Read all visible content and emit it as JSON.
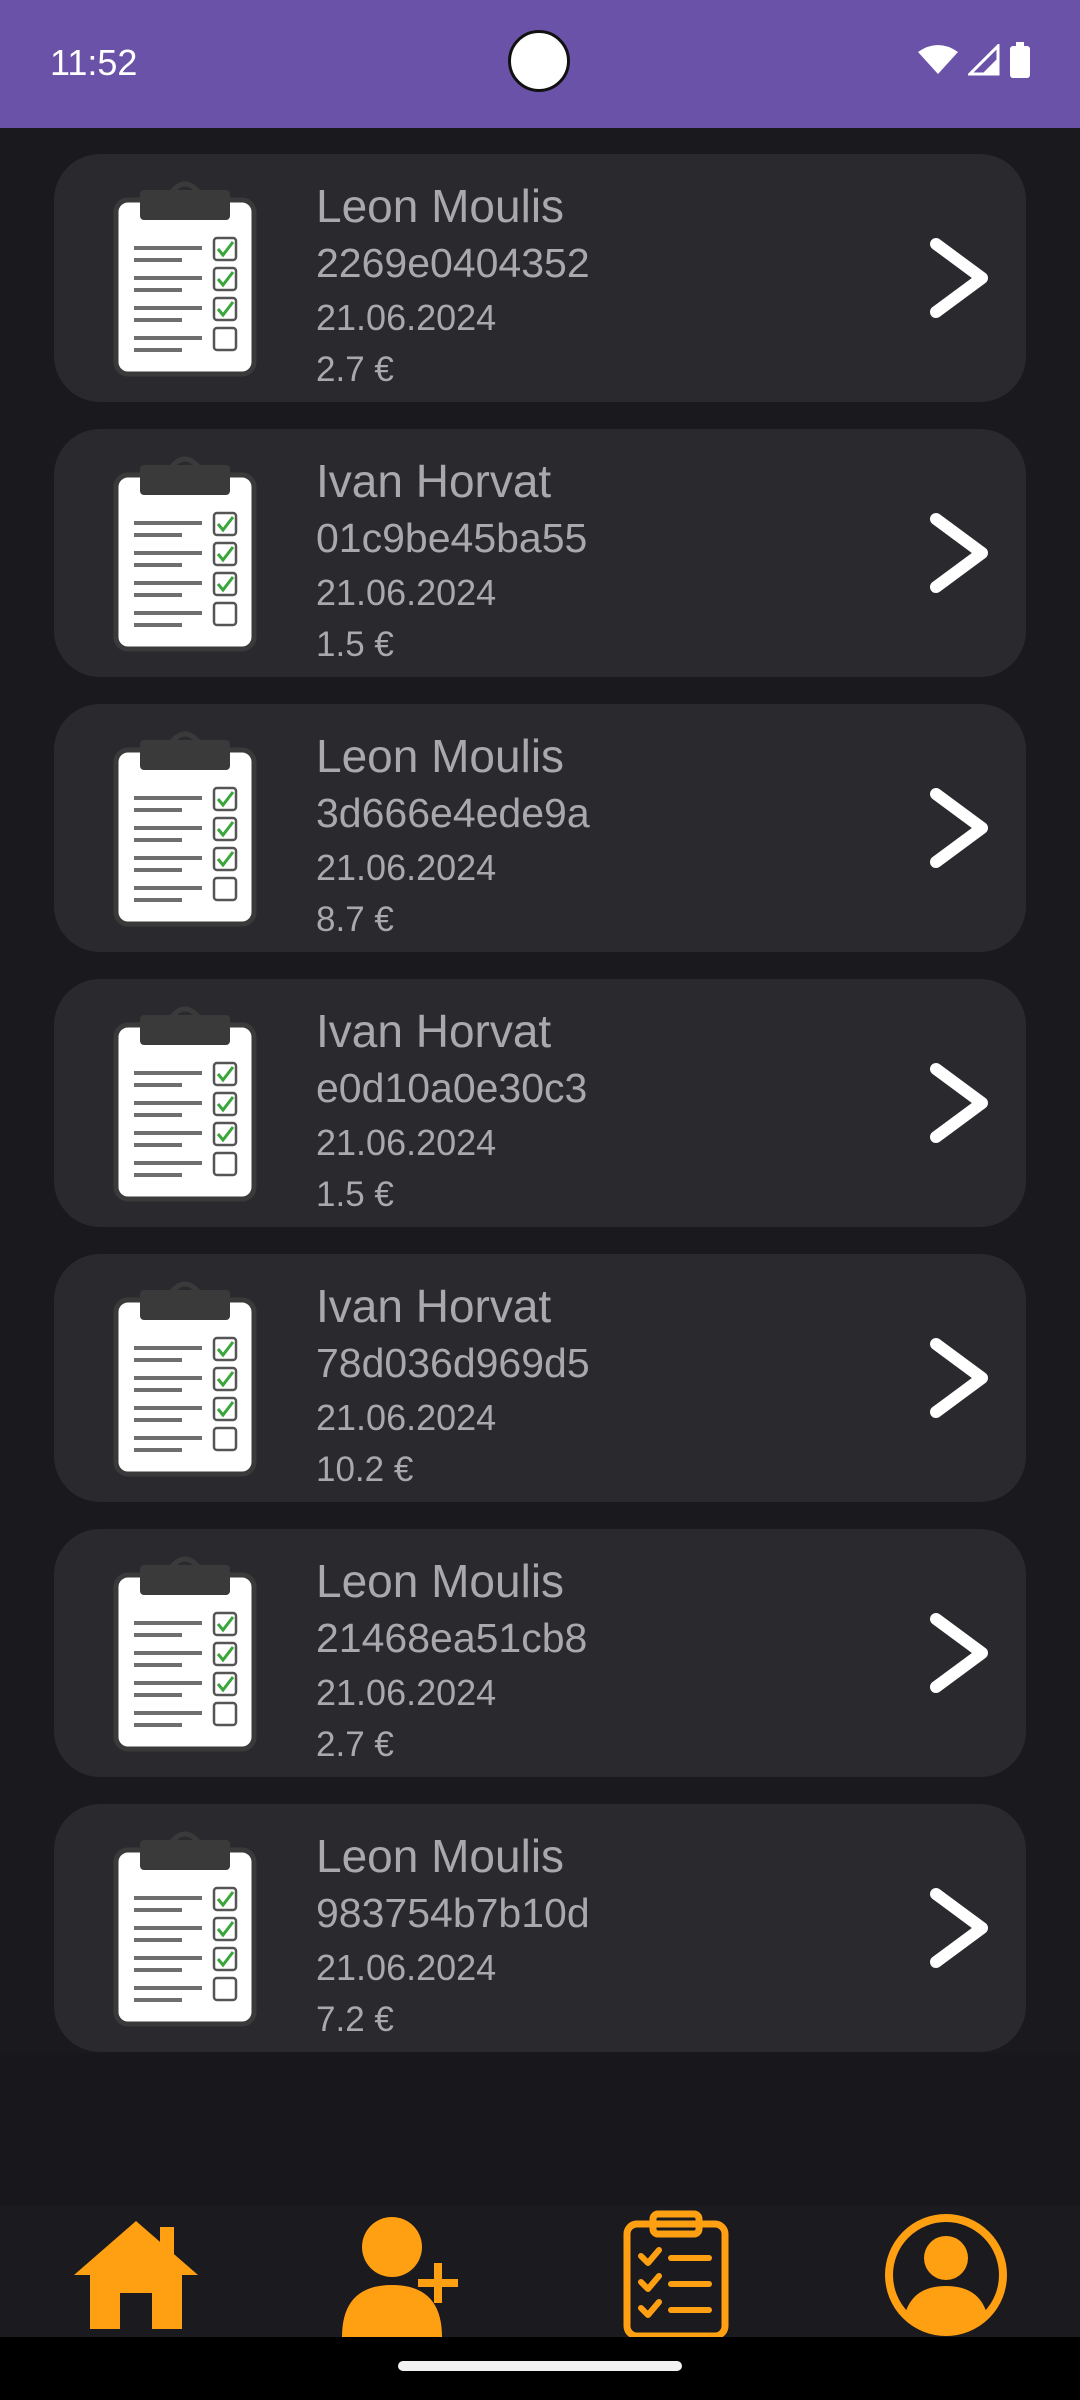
{
  "status_bar": {
    "time": "11:52"
  },
  "submissions": [
    {
      "name": "Leon Moulis",
      "code": "2269e0404352",
      "date": "21.06.2024",
      "price": "2.7 €"
    },
    {
      "name": "Ivan Horvat",
      "code": "01c9be45ba55",
      "date": "21.06.2024",
      "price": "1.5 €"
    },
    {
      "name": "Leon Moulis",
      "code": "3d666e4ede9a",
      "date": "21.06.2024",
      "price": "8.7 €"
    },
    {
      "name": "Ivan Horvat",
      "code": "e0d10a0e30c3",
      "date": "21.06.2024",
      "price": "1.5 €"
    },
    {
      "name": "Ivan Horvat",
      "code": "78d036d969d5",
      "date": "21.06.2024",
      "price": "10.2 €"
    },
    {
      "name": "Leon Moulis",
      "code": "21468ea51cb8",
      "date": "21.06.2024",
      "price": "2.7 €"
    },
    {
      "name": "Leon Moulis",
      "code": "983754b7b10d",
      "date": "21.06.2024",
      "price": "7.2 €"
    }
  ],
  "bottom_nav": {
    "items": [
      {
        "icon": "home-icon"
      },
      {
        "icon": "add-user-icon"
      },
      {
        "icon": "clipboard-checklist-icon"
      },
      {
        "icon": "account-circle-icon"
      }
    ]
  },
  "colors": {
    "status_bar": "#6a52a8",
    "background": "#1a191e",
    "card": "#2a292e",
    "text": "#a9a8ad",
    "accent": "#ff9f12"
  }
}
